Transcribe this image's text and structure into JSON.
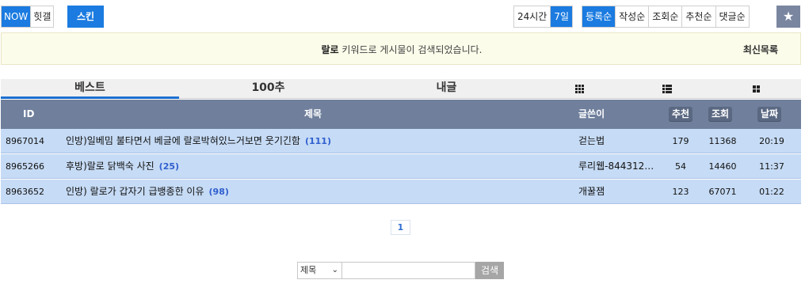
{
  "topbar": {
    "now_label": "NOW",
    "gallery_label": "힛갤",
    "skin_label": "스킨",
    "time_filters": [
      {
        "label": "24시간",
        "active": false
      },
      {
        "label": "7일",
        "active": true
      }
    ],
    "sort_filters": [
      {
        "label": "등록순",
        "active": true
      },
      {
        "label": "작성순",
        "active": false
      },
      {
        "label": "조회순",
        "active": false
      },
      {
        "label": "추천순",
        "active": false
      },
      {
        "label": "댓글순",
        "active": false
      }
    ],
    "favorite_icon": "star-icon"
  },
  "notice": {
    "keyword": "랄로",
    "message": " 키워드로 게시물이 검색되었습니다.",
    "latest_link": "최신목록"
  },
  "tabs": {
    "best": "베스트",
    "hundred": "100추",
    "mine": "내글",
    "view_icons": [
      "grid-view-icon",
      "list-view-icon",
      "card-view-icon"
    ]
  },
  "table": {
    "headers": {
      "id": "ID",
      "title": "제목",
      "author": "글쓴이",
      "recommend": "추천",
      "views": "조회",
      "date": "날짜"
    },
    "rows": [
      {
        "id": "8967014",
        "title": "인방)일베밈 불타면서 베글에 랄로박혀있느거보면 웃기긴함",
        "comments": "(111)",
        "author": "걷는법",
        "recommend": "179",
        "views": "11368",
        "date": "20:19"
      },
      {
        "id": "8965266",
        "title": "후방)랄로 닭백숙 사진",
        "comments": "(25)",
        "author": "루리웹-8443128…",
        "recommend": "54",
        "views": "14460",
        "date": "11:37"
      },
      {
        "id": "8963652",
        "title": "인방) 랄로가 갑자기 급뱅종한 이유",
        "comments": "(98)",
        "author": "개꿀잼",
        "recommend": "123",
        "views": "67071",
        "date": "01:22"
      }
    ]
  },
  "pagination": {
    "current": "1"
  },
  "search": {
    "select_value": "제목",
    "input_value": "",
    "button_label": "검색"
  }
}
